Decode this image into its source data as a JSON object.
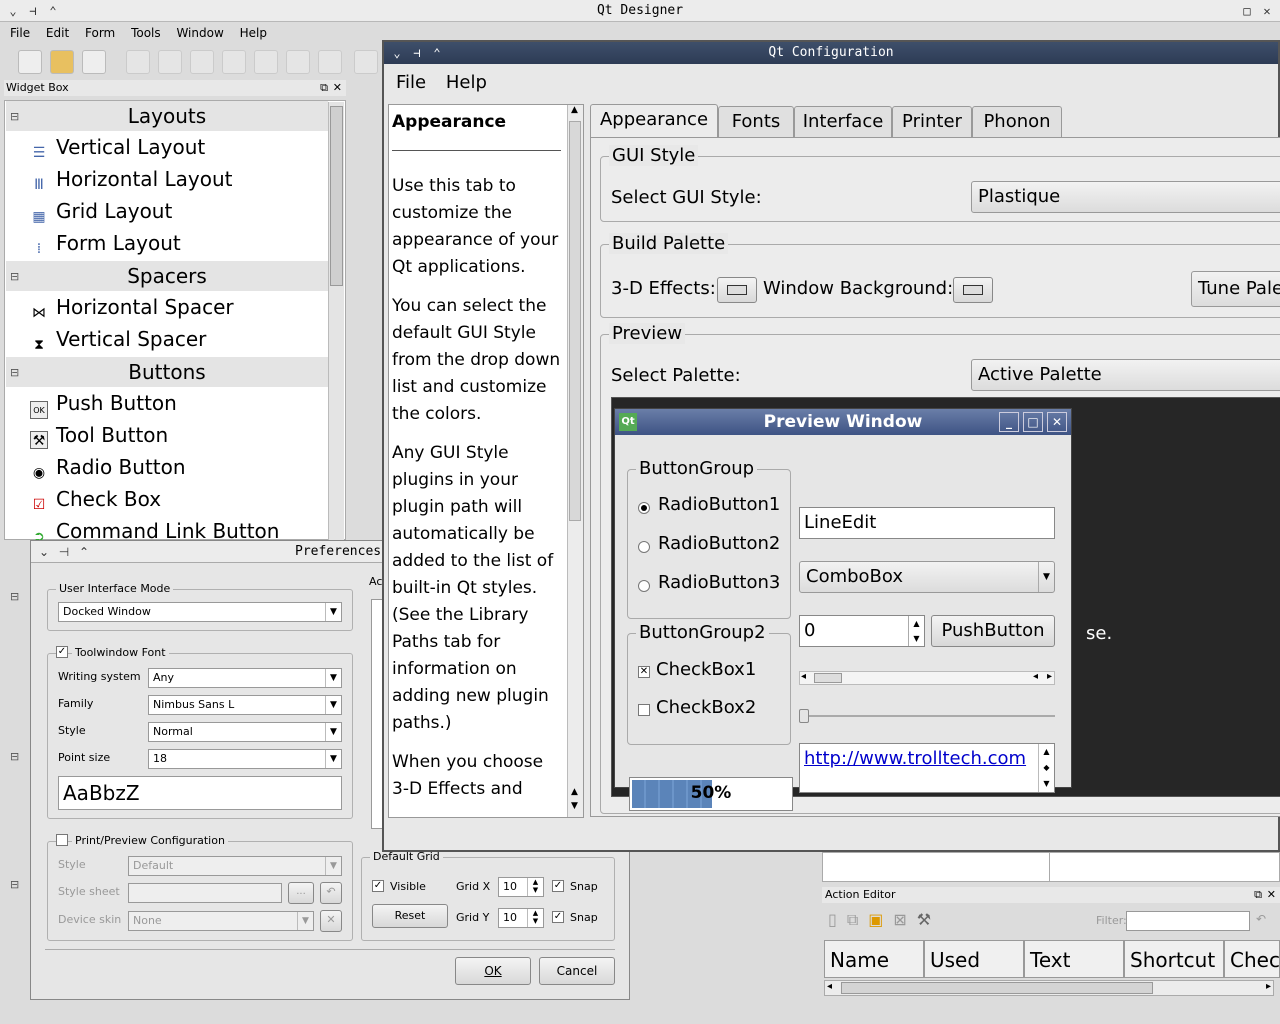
{
  "designer": {
    "title": "Qt Designer",
    "menu": [
      "File",
      "Edit",
      "Form",
      "Tools",
      "Window",
      "Help"
    ]
  },
  "widget_box": {
    "title": "Widget Box",
    "layouts": {
      "title": "Layouts",
      "items": [
        "Vertical Layout",
        "Horizontal Layout",
        "Grid Layout",
        "Form Layout"
      ]
    },
    "spacers": {
      "title": "Spacers",
      "items": [
        "Horizontal Spacer",
        "Vertical Spacer"
      ]
    },
    "buttons": {
      "title": "Buttons",
      "items": [
        "Push Button",
        "Tool Button",
        "Radio Button",
        "Check Box",
        "Command Link Button"
      ]
    }
  },
  "preferences": {
    "title": "Preferences",
    "ui_mode_label": "User Interface Mode",
    "ui_mode_value": "Docked Window",
    "toolwindow_font": "Toolwindow Font",
    "writing_system_label": "Writing system",
    "writing_system_value": "Any",
    "family_label": "Family",
    "family_value": "Nimbus Sans L",
    "style_label": "Style",
    "style_value": "Normal",
    "point_size_label": "Point size",
    "point_size_value": "18",
    "sample": "AaBbzZ",
    "print_preview": "Print/Preview Configuration",
    "pp_style_label": "Style",
    "pp_style_value": "Default",
    "pp_sheet_label": "Style sheet",
    "pp_sheet_btn": "...",
    "pp_skin_label": "Device skin",
    "pp_skin_value": "None",
    "ac_label": "Ac",
    "default_grid": "Default Grid",
    "visible": "Visible",
    "reset": "Reset",
    "grid_x_label": "Grid X",
    "grid_x": "10",
    "grid_y_label": "Grid Y",
    "grid_y": "10",
    "snap": "Snap",
    "ok": "OK",
    "cancel": "Cancel"
  },
  "qtconfig": {
    "title": "Qt Configuration",
    "menu": [
      "File",
      "Help"
    ],
    "help_title": "Appearance",
    "help_paragraphs": [
      "Use this tab to customize the appearance of your Qt applications.",
      "You can select the default GUI Style from the drop down list and customize the colors.",
      "Any GUI Style plugins in your plugin path will automatically be added to the list of built-in Qt styles. (See the Library Paths tab for information on adding new plugin paths.)",
      "When you choose 3-D Effects and"
    ],
    "tabs": [
      "Appearance",
      "Fonts",
      "Interface",
      "Printer",
      "Phonon"
    ],
    "gui_style_group": "GUI Style",
    "select_gui_style": "Select GUI Style:",
    "gui_style_value": "Plastique",
    "build_palette": "Build Palette",
    "effects_3d": "3-D Effects:",
    "window_bg": "Window Background:",
    "tune_palette": "Tune Pale",
    "preview_group": "Preview",
    "select_palette": "Select Palette:",
    "palette_value": "Active Palette",
    "behind_text": "se."
  },
  "preview": {
    "title": "Preview Window",
    "bg1": "ButtonGroup",
    "radios": [
      "RadioButton1",
      "RadioButton2",
      "RadioButton3"
    ],
    "line_edit": "LineEdit",
    "combo": "ComboBox",
    "spin": "0",
    "push": "PushButton",
    "bg2": "ButtonGroup2",
    "checks": [
      "CheckBox1",
      "CheckBox2"
    ],
    "progress_text": "50%",
    "progress": 0.5,
    "link": "http://www.trolltech.com"
  },
  "action_editor": {
    "title": "Action Editor",
    "filter": "Filter:",
    "columns": [
      "Name",
      "Used",
      "Text",
      "Shortcut",
      "Chec"
    ]
  }
}
